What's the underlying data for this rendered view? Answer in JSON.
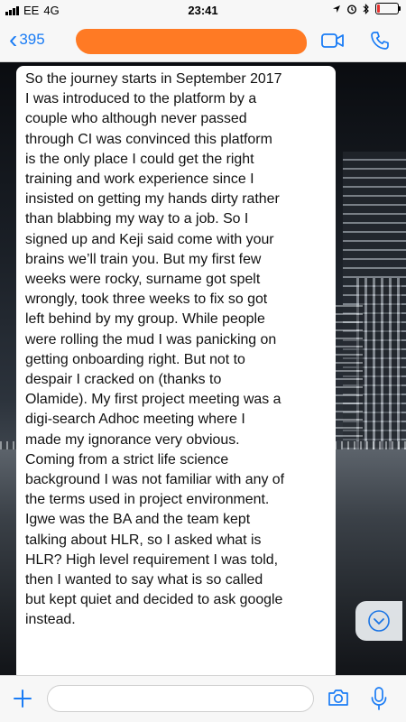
{
  "status_bar": {
    "carrier": "EE",
    "network": "4G",
    "time": "23:41",
    "battery_color": "#e8332f"
  },
  "header": {
    "back_count": "395",
    "contact_name_redacted_color": "#ff7a24",
    "accent_color": "#1a7cf5",
    "icons": [
      "video-call-icon",
      "phone-icon"
    ]
  },
  "message": {
    "text": "So the journey starts in September 2017\nI was introduced to the platform by a\ncouple who although never passed\nthrough CI was convinced this platform\nis the only place I could get the right\ntraining and work experience since I\ninsisted on getting my hands dirty rather\nthan blabbing my way to a job. So I\nsigned up and Keji said come with your\nbrains we’ll train you. But my first few\nweeks were rocky, surname got spelt\nwrongly, took three weeks to fix so got\nleft behind by my group. While people\nwere rolling the mud I was panicking on\ngetting onboarding right. But not to\ndespair I cracked on (thanks to\nOlamide). My first project meeting was a\ndigi-search Adhoc meeting where I\nmade my ignorance very obvious.\nComing from a strict life science\nbackground I was not familiar with any of\nthe terms used in project environment.\nIgwe was the BA and the team kept\ntalking about HLR, so I asked what is\nHLR? High level requirement I was told,\nthen I wanted to say what is so called\nbut kept quiet and decided to ask google\ninstead."
  },
  "input_bar": {
    "text_value": "",
    "icons": [
      "plus-icon",
      "camera-icon",
      "microphone-icon"
    ]
  }
}
